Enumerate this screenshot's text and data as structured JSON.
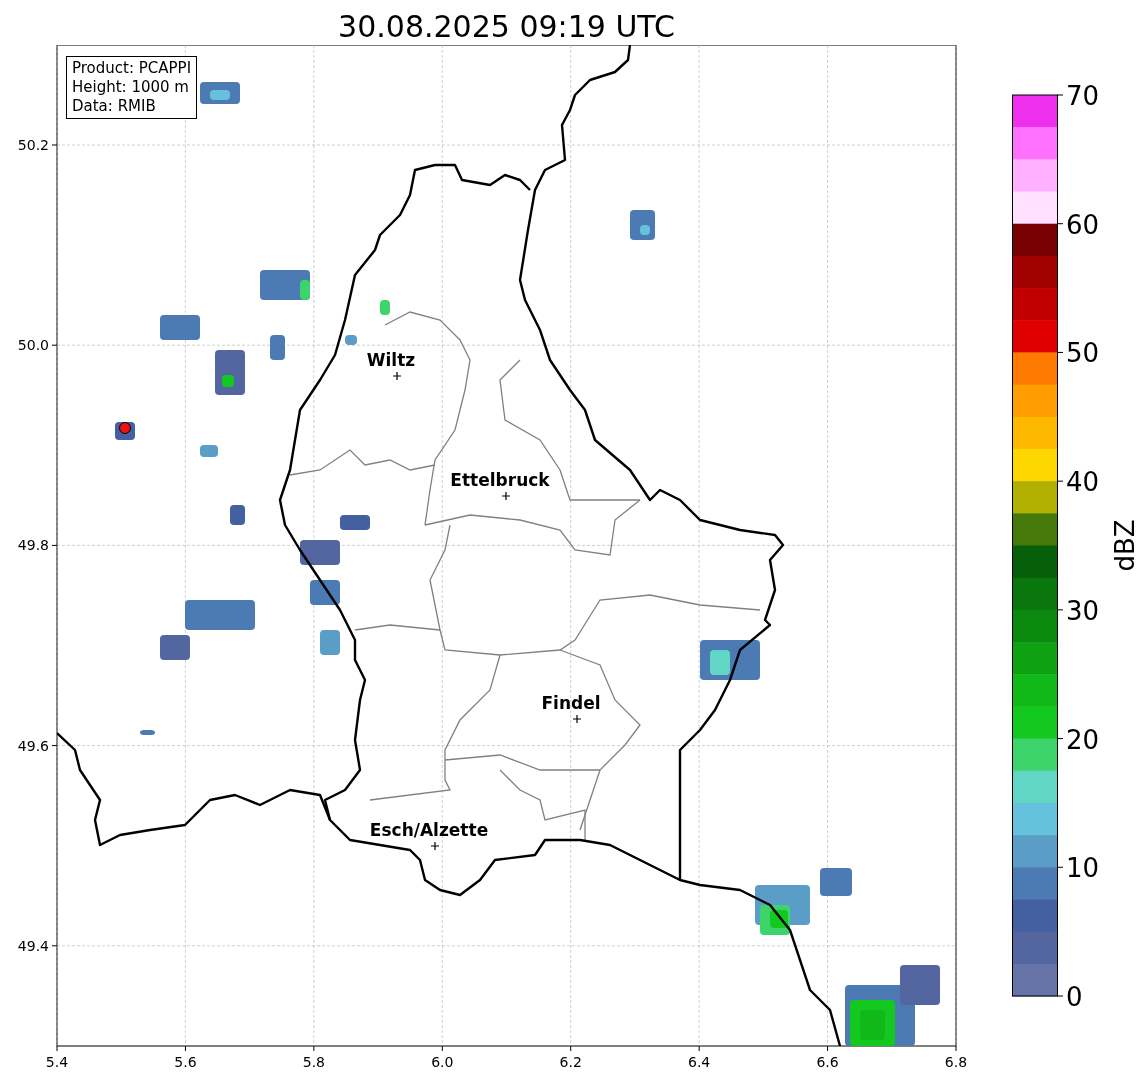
{
  "map": {
    "title": "30.08.2025 09:19 UTC",
    "y_tick_labels": [
      "50.2",
      "50.0",
      "49.8",
      "49.6",
      "49.4"
    ],
    "x_tick_labels": [
      "5.4",
      "5.6",
      "5.8",
      "6.0",
      "6.2",
      "6.4",
      "6.6",
      "6.8"
    ],
    "places": [
      {
        "name": "Wiltz"
      },
      {
        "name": "Ettelbruck"
      },
      {
        "name": "Findel"
      },
      {
        "name": "Esch/Alzette"
      }
    ]
  },
  "radar_site": {
    "color": "#ee1111"
  },
  "info_box": [
    "Product: PCAPPI",
    "Height: 1000 m",
    "Data: RMIB"
  ],
  "colorbar": {
    "label": "dBZ",
    "ticks": [
      "70",
      "60",
      "50",
      "40",
      "30",
      "20",
      "10",
      "0"
    ],
    "segments": [
      {
        "color": "#ee30ee"
      },
      {
        "color": "#ff70ff"
      },
      {
        "color": "#ffb0ff"
      },
      {
        "color": "#ffe0ff"
      },
      {
        "color": "#780000"
      },
      {
        "color": "#a00000"
      },
      {
        "color": "#c00000"
      },
      {
        "color": "#e00000"
      },
      {
        "color": "#ff7a00"
      },
      {
        "color": "#ff9c00"
      },
      {
        "color": "#ffb800"
      },
      {
        "color": "#ffd700"
      },
      {
        "color": "#b0b000"
      },
      {
        "color": "#457a0a"
      },
      {
        "color": "#065f0a"
      },
      {
        "color": "#0a760e"
      },
      {
        "color": "#0c8a10"
      },
      {
        "color": "#0ea212"
      },
      {
        "color": "#10b818"
      },
      {
        "color": "#13c81e"
      },
      {
        "color": "#3dd46c"
      },
      {
        "color": "#62d6c4"
      },
      {
        "color": "#66c1dd"
      },
      {
        "color": "#5a9ec8"
      },
      {
        "color": "#4c7bb3"
      },
      {
        "color": "#4360a0"
      },
      {
        "color": "#5466a0"
      },
      {
        "color": "#6673a6"
      }
    ]
  }
}
